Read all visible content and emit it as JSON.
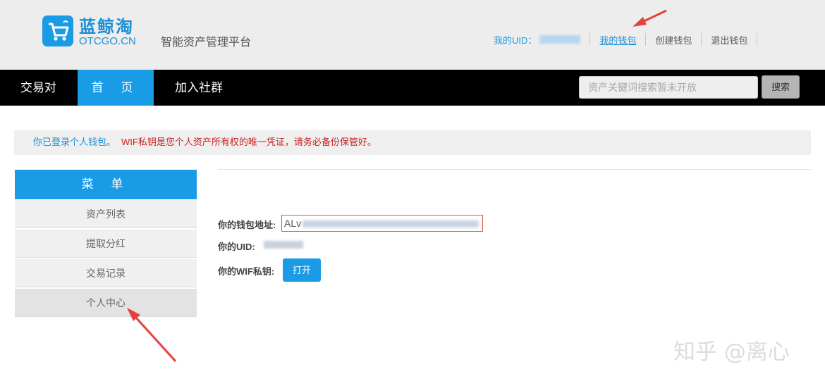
{
  "header": {
    "logo_name": "蓝鲸淘",
    "logo_domain": "OTCGO.CN",
    "platform_title": "智能资产管理平台",
    "uid_label": "我的UID：",
    "links": {
      "my_wallet": "我的钱包",
      "create_wallet": "创建钱包",
      "exit_wallet": "退出钱包"
    }
  },
  "nav": {
    "items": [
      {
        "label": "交易对"
      },
      {
        "label": "首 页",
        "active": true
      },
      {
        "label": "加入社群"
      }
    ],
    "search_placeholder": "资产关键词搜索暂未开放",
    "search_button": "搜索"
  },
  "notice": {
    "blue_text": "你已登录个人钱包。",
    "red_text": "WIF私钥是您个人资产所有权的唯一凭证，请务必备份保管好。"
  },
  "sidebar": {
    "title": "菜 单",
    "items": [
      {
        "label": "资产列表"
      },
      {
        "label": "提取分红"
      },
      {
        "label": "交易记录"
      },
      {
        "label": "个人中心",
        "selected": true
      }
    ]
  },
  "main": {
    "address_label": "你的钱包地址:",
    "address_prefix": "ALv",
    "uid_label": "你的UID:",
    "wif_label": "你的WIF私钥:",
    "open_button": "打开"
  },
  "watermark": "知乎 @离心",
  "colors": {
    "primary_blue": "#1a9be6",
    "warning_red": "#cc2222",
    "nav_black": "#000000",
    "header_gray": "#ededed",
    "annotation_red": "#e8403a"
  }
}
